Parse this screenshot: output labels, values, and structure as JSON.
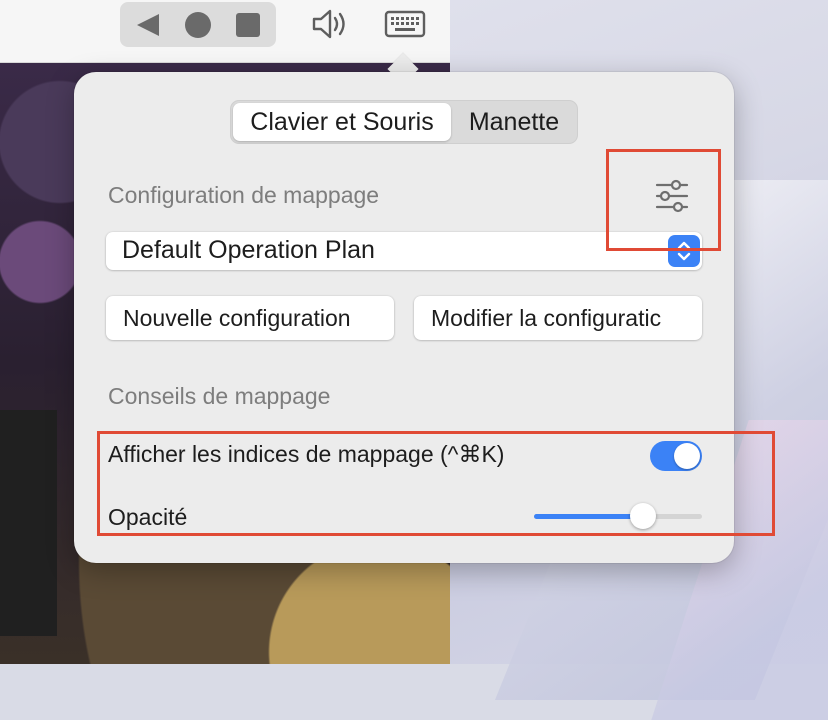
{
  "colors": {
    "accent": "#3b82f6",
    "highlight": "#e04a35",
    "popover_bg": "#ececec"
  },
  "titlebar": {
    "nav_icons": [
      "back-icon",
      "home-icon",
      "recents-icon"
    ],
    "tool_icons": [
      "speaker-icon",
      "keyboard-icon"
    ]
  },
  "popover": {
    "tabs": [
      {
        "label": "Clavier et Souris",
        "selected": true
      },
      {
        "label": "Manette",
        "selected": false
      }
    ],
    "mapping_config": {
      "section_title": "Configuration de mappage",
      "settings_icon": "sliders-icon",
      "selected_plan": "Default Operation Plan",
      "new_button": "Nouvelle configuration",
      "edit_button": "Modifier la configuratic"
    },
    "mapping_tips": {
      "section_title": "Conseils de mappage",
      "show_hints_label": "Afficher les indices de mappage (^⌘K)",
      "show_hints_on": true,
      "opacity_label": "Opacité",
      "opacity_value": 0.65
    }
  }
}
